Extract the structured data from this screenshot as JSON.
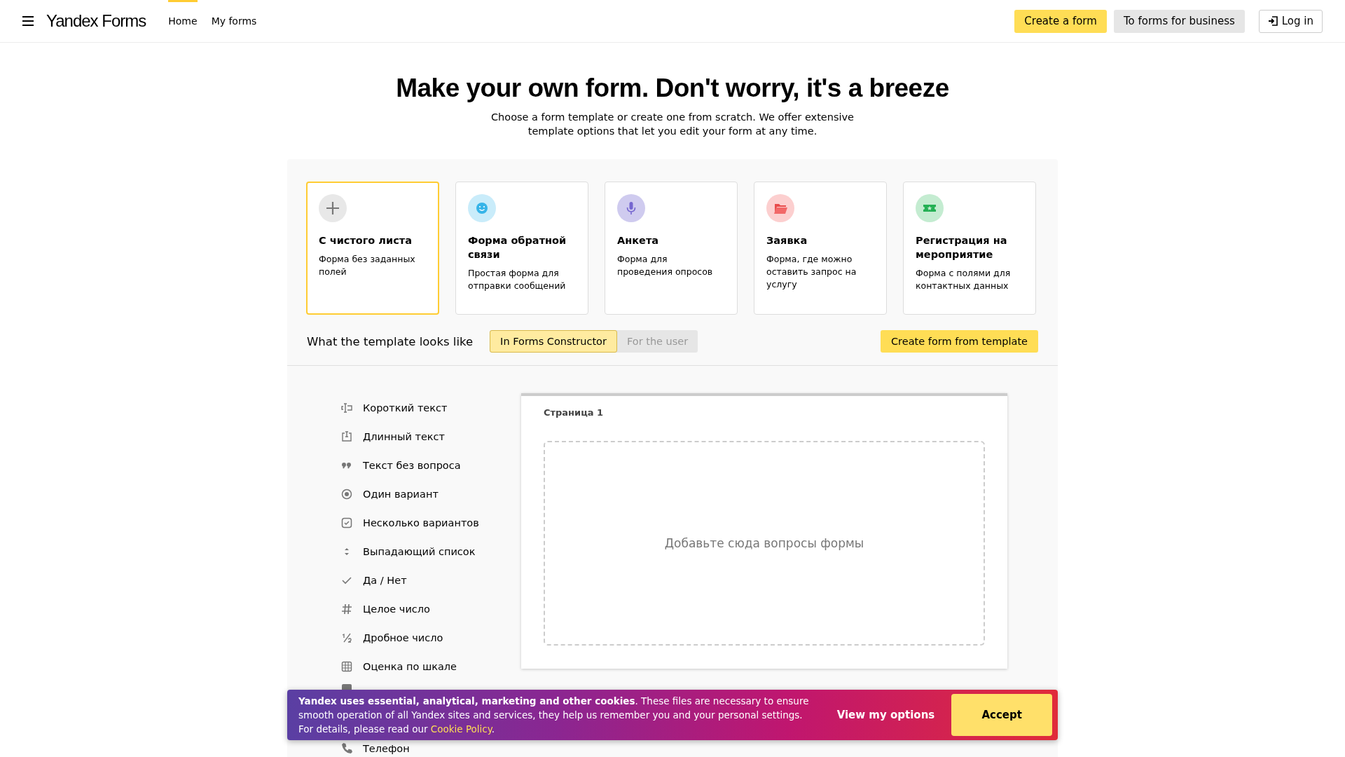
{
  "header": {
    "logo": "Yandex Forms",
    "nav": [
      {
        "label": "Home",
        "selected": true
      },
      {
        "label": "My forms",
        "selected": false
      }
    ],
    "actions": [
      {
        "label": "Create a form",
        "kind": "primary"
      },
      {
        "label": "To forms for business",
        "kind": "secondary"
      },
      {
        "label": "Log in",
        "kind": "login"
      }
    ]
  },
  "hero": {
    "title": "Make your own form. Don't worry, it's a breeze",
    "subtitle": "Choose a form template or create one from scratch. We offer extensive template options that let you edit your form at any time."
  },
  "templates": [
    {
      "kind": "blank",
      "title": "С чистого листа",
      "description": "Форма без заданных полей",
      "selected": true
    },
    {
      "kind": "feedback",
      "title": "Форма обратной связи",
      "description": "Простая форма для отправки сообщений",
      "selected": false
    },
    {
      "kind": "survey",
      "title": "Анкета",
      "description": "Форма для проведения опросов",
      "selected": false
    },
    {
      "kind": "request",
      "title": "Заявка",
      "description": "Форма, где можно оставить запрос на услугу",
      "selected": false
    },
    {
      "kind": "event",
      "title": "Регистрация на мероприятие",
      "description": "Форма с полями для контактных данных",
      "selected": false
    }
  ],
  "preview_bar": {
    "label": "What the template looks like",
    "tabs": [
      {
        "label": "In Forms Constructor",
        "selected": true
      },
      {
        "label": "For the user",
        "selected": false
      }
    ],
    "action": "Create form from template"
  },
  "question_types": [
    {
      "kind": "short",
      "label": "Короткий текст"
    },
    {
      "kind": "long",
      "label": "Длинный текст"
    },
    {
      "kind": "quote",
      "label": "Текст без вопроса"
    },
    {
      "kind": "radio",
      "label": "Один вариант"
    },
    {
      "kind": "check",
      "label": "Несколько вариантов"
    },
    {
      "kind": "select",
      "label": "Выпадающий список"
    },
    {
      "kind": "yesno",
      "label": "Да / Нет"
    },
    {
      "kind": "integer",
      "label": "Целое число"
    },
    {
      "kind": "fraction",
      "label": "Дробное число"
    },
    {
      "kind": "scale",
      "label": "Оценка по шкале"
    },
    {
      "kind": "date"
    },
    {
      "kind": "phone",
      "label": "Телефон"
    }
  ],
  "canvas": {
    "page_title": "Страница 1",
    "placeholder": "Добавьте сюда вопросы формы"
  },
  "cookie_banner": {
    "text": "**Yandex uses essential, analytical, marketing and other cookies**. These files are necessary to ensure smooth operation of all Yandex sites and services, they help us remember you and your personal settings. For details, please read our ",
    "link": "Cookie Policy",
    "after": ".",
    "options": "View my options",
    "accept": "Accept"
  }
}
